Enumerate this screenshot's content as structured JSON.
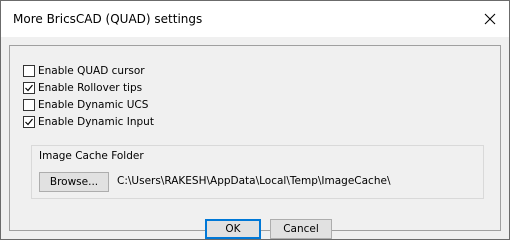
{
  "window": {
    "title": "More BricsCAD (QUAD) settings"
  },
  "options": [
    {
      "label": "Enable QUAD cursor",
      "checked": false
    },
    {
      "label": "Enable Rollover tips",
      "checked": true
    },
    {
      "label": "Enable Dynamic UCS",
      "checked": false
    },
    {
      "label": "Enable Dynamic Input",
      "checked": true
    }
  ],
  "image_cache": {
    "group_label": "Image Cache Folder",
    "browse_label": "Browse...",
    "path": "C:\\Users\\RAKESH\\AppData\\Local\\Temp\\ImageCache\\"
  },
  "footer": {
    "ok_label": "OK",
    "cancel_label": "Cancel"
  },
  "icons": {
    "close": "close-icon",
    "check": "checkmark-icon"
  },
  "colors": {
    "title_bg": "#ffffff",
    "dialog_bg": "#f0f0f0",
    "focus_border": "#0078d7"
  }
}
